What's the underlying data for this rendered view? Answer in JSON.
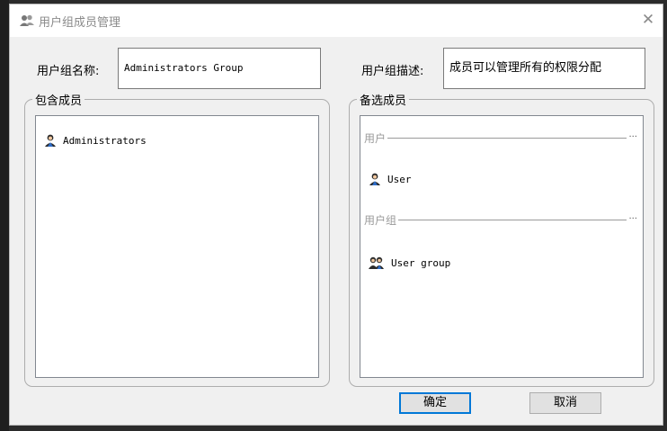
{
  "window": {
    "title": "用户组成员管理",
    "close_glyph": "✕"
  },
  "form": {
    "name_label": "用户组名称:",
    "name_value": "Administrators Group",
    "desc_label": "用户组描述:",
    "desc_value": "成员可以管理所有的权限分配"
  },
  "members": {
    "legend": "包含成员",
    "items": [
      {
        "label": "Administrators",
        "icon": "user-icon"
      }
    ]
  },
  "candidates": {
    "legend": "备选成员",
    "users_header": "用户",
    "users": [
      {
        "label": "User",
        "icon": "user-icon"
      }
    ],
    "groups_header": "用户组",
    "groups": [
      {
        "label": "User group",
        "icon": "user-group-icon"
      }
    ],
    "more_glyph": "···"
  },
  "buttons": {
    "ok": "确定",
    "cancel": "取消"
  },
  "colors": {
    "accent": "#0078d7",
    "background": "#f0f0f0",
    "title_text": "#8a8a8a"
  }
}
